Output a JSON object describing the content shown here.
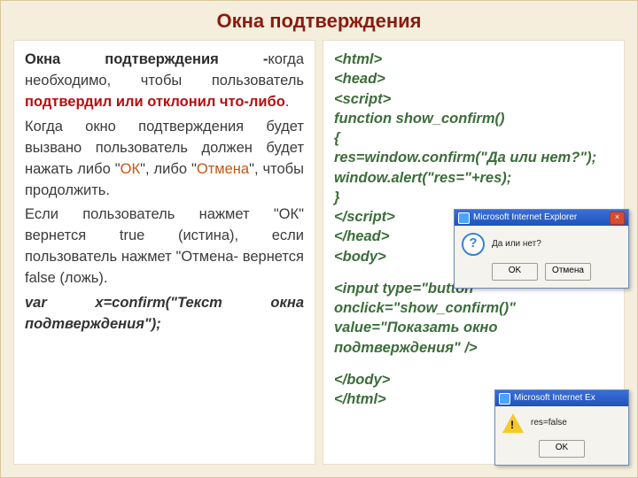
{
  "title": "Окна подтверждения",
  "left": {
    "p1_lead": "Окна подтверждения -",
    "p1_rest": "когда необходимо, чтобы пользователь ",
    "p1_red": "подтвердил или отклонил что-либо",
    "p1_end": ".",
    "p2a": "Когда окно подтверждения будет вызвано пользователь должен будет нажать либо \"",
    "p2_ok": "ОК",
    "p2b": "\", либо \"",
    "p2_cancel": "Отмена",
    "p2c": "\", чтобы продолжить.",
    "p3": "Если пользователь нажмет \"ОК\" вернется true (истина), если пользователь нажмет \"Отмена- вернется false (ложь).",
    "syntax": "var x=confirm(\"Текст окна подтверждения\");"
  },
  "code": {
    "l1": "<html>",
    "l2": "<head>",
    "l3": "<script>",
    "l4": "function show_confirm()",
    "l5": "{",
    "l6": "res=window.confirm(\"Да или нет?\");",
    "l7": "window.alert(\"res=\"+res);",
    "l8": "}",
    "l9": "</script>",
    "l10": "</head>",
    "l11": "<body>",
    "blank": " ",
    "l12": "<input type=\"button\" onclick=\"show_confirm()\" value=\"Показать окно подтверждения\" />",
    "l13": "</body>",
    "l14": "</html>"
  },
  "dialog1": {
    "title": "Microsoft Internet Explorer",
    "message": "Да или нет?",
    "ok": "OK",
    "cancel": "Отмена"
  },
  "dialog2": {
    "title": "Microsoft Internet Ex",
    "message": "res=false",
    "ok": "OK"
  }
}
